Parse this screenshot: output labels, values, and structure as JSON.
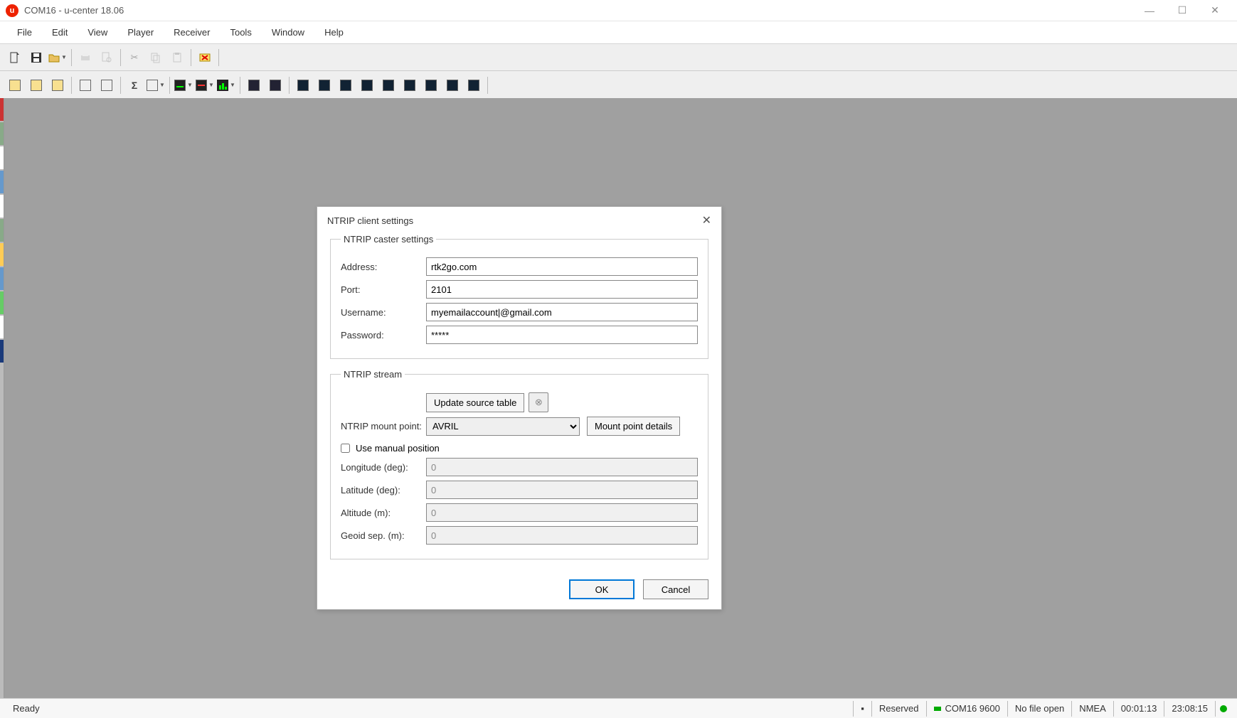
{
  "titlebar": {
    "title": "COM16 - u-center 18.06",
    "appIconLetter": "u"
  },
  "menu": {
    "file": "File",
    "edit": "Edit",
    "view": "View",
    "player": "Player",
    "receiver": "Receiver",
    "tools": "Tools",
    "window": "Window",
    "help": "Help"
  },
  "dialog": {
    "title": "NTRIP client settings",
    "caster": {
      "legend": "NTRIP caster settings",
      "addressLabel": "Address:",
      "addressValue": "rtk2go.com",
      "portLabel": "Port:",
      "portValue": "2101",
      "usernameLabel": "Username:",
      "usernameValue": "myemailaccount|@gmail.com",
      "passwordLabel": "Password:",
      "passwordValue": "*****"
    },
    "stream": {
      "legend": "NTRIP stream",
      "updateBtn": "Update source table",
      "mountLabel": "NTRIP mount point:",
      "mountValue": "AVRIL",
      "detailsBtn": "Mount point details",
      "manualLabel": "Use manual position",
      "lonLabel": "Longitude (deg):",
      "lonValue": "0",
      "latLabel": "Latitude (deg):",
      "latValue": "0",
      "altLabel": "Altitude (m):",
      "altValue": "0",
      "geoidLabel": "Geoid sep. (m):",
      "geoidValue": "0"
    },
    "okLabel": "OK",
    "cancelLabel": "Cancel"
  },
  "statusbar": {
    "ready": "Ready",
    "reserved": "Reserved",
    "port": "COM16 9600",
    "file": "No file open",
    "proto": "NMEA",
    "t1": "00:01:13",
    "t2": "23:08:15"
  }
}
